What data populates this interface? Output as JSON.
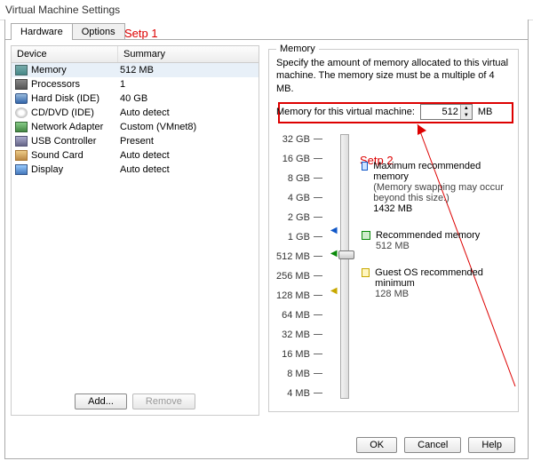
{
  "window_title": "Virtual Machine Settings",
  "tabs": {
    "hardware": "Hardware",
    "options": "Options"
  },
  "annotations": {
    "step1": "Setp 1",
    "step2": "Setp 2"
  },
  "list_header": {
    "device": "Device",
    "summary": "Summary"
  },
  "devices": [
    {
      "name": "Memory",
      "summary": "512 MB",
      "icon": "icon-mem",
      "selected": true
    },
    {
      "name": "Processors",
      "summary": "1",
      "icon": "icon-cpu"
    },
    {
      "name": "Hard Disk (IDE)",
      "summary": "40 GB",
      "icon": "icon-hdd"
    },
    {
      "name": "CD/DVD (IDE)",
      "summary": "Auto detect",
      "icon": "icon-cd"
    },
    {
      "name": "Network Adapter",
      "summary": "Custom (VMnet8)",
      "icon": "icon-net"
    },
    {
      "name": "USB Controller",
      "summary": "Present",
      "icon": "icon-usb"
    },
    {
      "name": "Sound Card",
      "summary": "Auto detect",
      "icon": "icon-snd"
    },
    {
      "name": "Display",
      "summary": "Auto detect",
      "icon": "icon-disp"
    }
  ],
  "left_buttons": {
    "add": "Add...",
    "remove": "Remove"
  },
  "memory_panel": {
    "title": "Memory",
    "description": "Specify the amount of memory allocated to this virtual machine. The memory size must be a multiple of 4 MB.",
    "input_label": "Memory for this virtual machine:",
    "value": "512",
    "unit": "MB",
    "scale": [
      "32 GB",
      "16 GB",
      "8 GB",
      "4 GB",
      "2 GB",
      "1 GB",
      "512 MB",
      "256 MB",
      "128 MB",
      "64 MB",
      "32 MB",
      "16 MB",
      "8 MB",
      "4 MB"
    ],
    "legend": {
      "max": {
        "label": "Maximum recommended memory",
        "note": "(Memory swapping may occur beyond this size.)",
        "value": "1432 MB"
      },
      "rec": {
        "label": "Recommended memory",
        "value": "512 MB"
      },
      "min": {
        "label": "Guest OS recommended minimum",
        "value": "128 MB"
      }
    }
  },
  "bottom_buttons": {
    "ok": "OK",
    "cancel": "Cancel",
    "help": "Help"
  }
}
